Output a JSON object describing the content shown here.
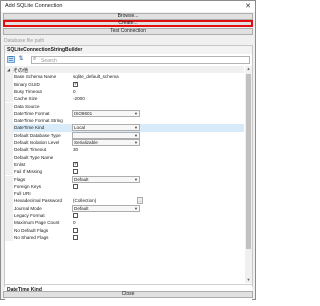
{
  "window": {
    "title": "Add SQLite Connection",
    "close_glyph": "✕"
  },
  "buttons": {
    "browse": "Browse...",
    "create": "Create...",
    "test": "Test Connection"
  },
  "database_file_path_label": "Database file path",
  "property_grid": {
    "title": "SQLiteConnectionStringBuilder",
    "toolbar": {
      "categorized_icon": "☰",
      "alphabetical_icon": "⇅",
      "search_placeholder": "Search"
    },
    "category": {
      "expanded_glyph": "◢",
      "name": "その他"
    },
    "rows": [
      {
        "key": "Base Schema Name",
        "value": "sqlite_default_schema"
      },
      {
        "key": "Binary GUID",
        "checkbox": true
      },
      {
        "key": "Busy Timeout",
        "value": "0"
      },
      {
        "key": "Cache Size",
        "value": "-2000"
      },
      {
        "key": "Data Source",
        "value": ""
      },
      {
        "key": "DateTime Format",
        "dropdown": "ISO8601"
      },
      {
        "key": "DateTime Format String",
        "value": ""
      },
      {
        "key": "DateTime Kind",
        "dropdown": "Local",
        "selected": true
      },
      {
        "key": "Default Database Type",
        "dropdown": ""
      },
      {
        "key": "Default Isolation Level",
        "dropdown": "Serializable"
      },
      {
        "key": "Default Timeout",
        "value": "30"
      },
      {
        "key": "Default Type Name",
        "value": ""
      },
      {
        "key": "Enlist",
        "checkbox": true
      },
      {
        "key": "Fail If Missing",
        "checkbox": false
      },
      {
        "key": "Flags",
        "dropdown": "Default"
      },
      {
        "key": "Foreign Keys",
        "checkbox": false
      },
      {
        "key": "Full URI",
        "value": ""
      },
      {
        "key": "Hexadecimal Password",
        "value": "(Collection)",
        "ellipsis": "..."
      },
      {
        "key": "Journal Mode",
        "dropdown": "Default"
      },
      {
        "key": "Legacy Format",
        "checkbox": false
      },
      {
        "key": "Maximum Page Count",
        "value": "0"
      },
      {
        "key": "No Default Flags",
        "checkbox": false
      },
      {
        "key": "No Shared Flags",
        "checkbox": false
      }
    ],
    "description": {
      "title": "DateTime Kind"
    }
  },
  "footer": {
    "close": "Close"
  },
  "colors": {
    "highlight_border": "#e01010",
    "selected_row": "#d9ebf9"
  }
}
